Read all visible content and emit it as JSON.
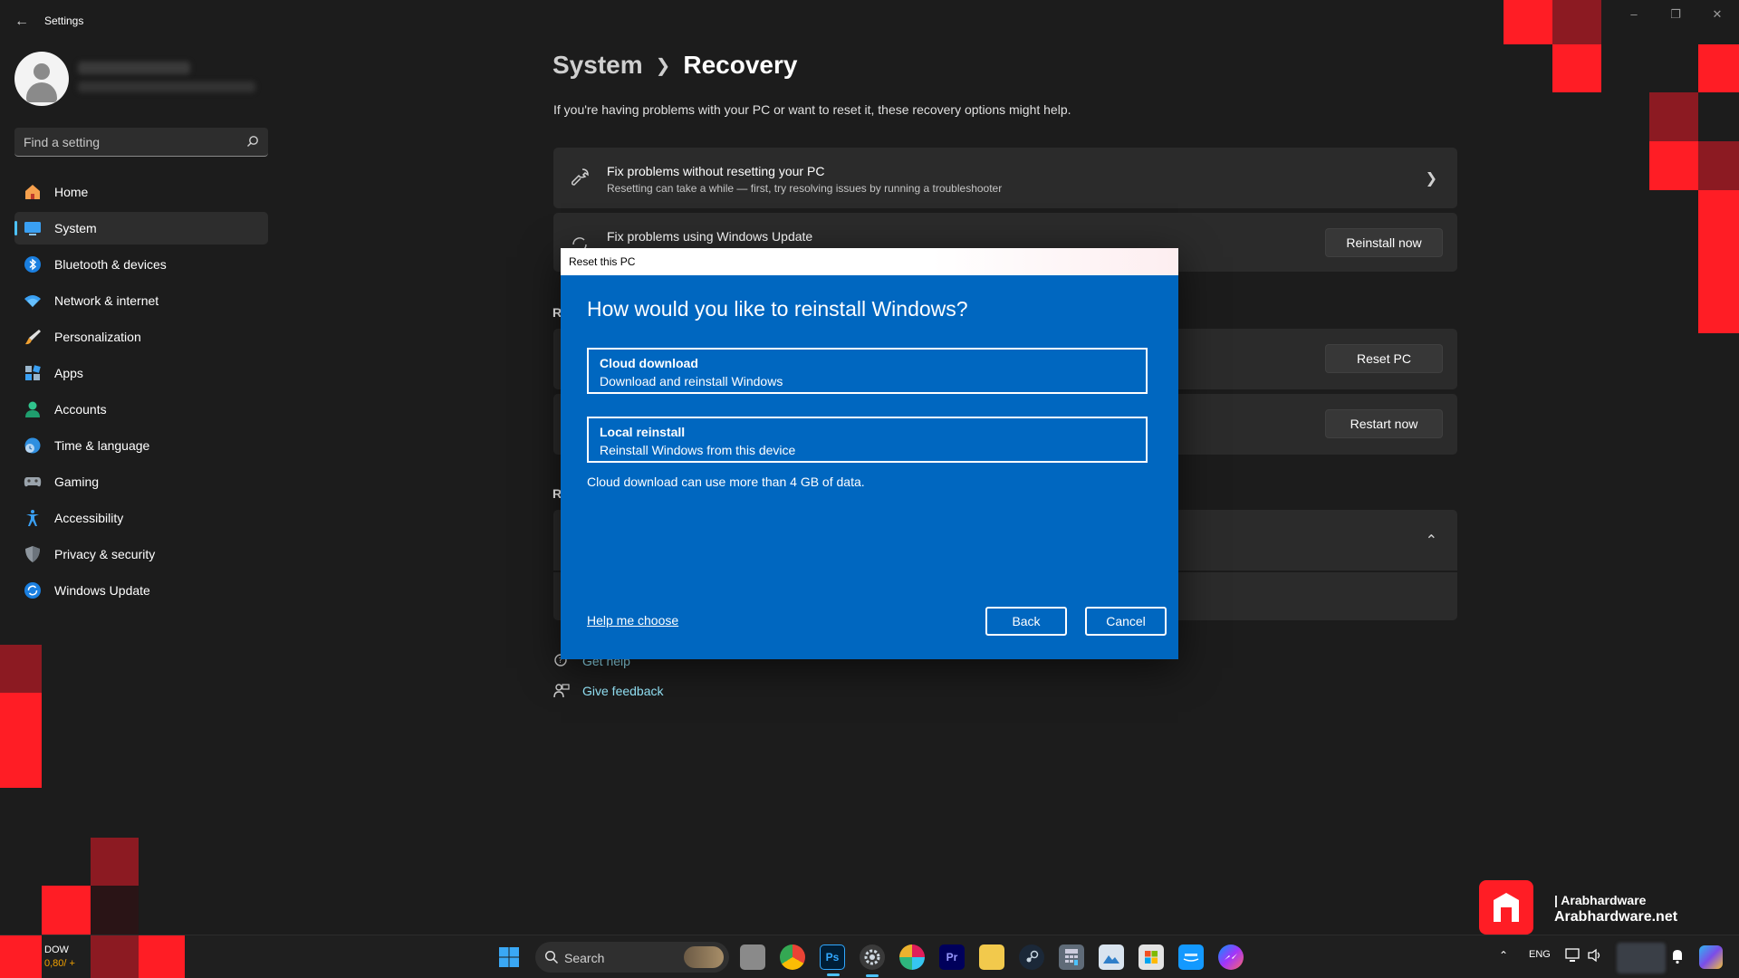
{
  "window": {
    "title": "Settings"
  },
  "search": {
    "placeholder": "Find a setting"
  },
  "sidebar": {
    "items": [
      {
        "label": "Home",
        "icon": "home-icon"
      },
      {
        "label": "System",
        "icon": "monitor-icon"
      },
      {
        "label": "Bluetooth & devices",
        "icon": "bluetooth-icon"
      },
      {
        "label": "Network & internet",
        "icon": "wifi-icon"
      },
      {
        "label": "Personalization",
        "icon": "brush-icon"
      },
      {
        "label": "Apps",
        "icon": "apps-icon"
      },
      {
        "label": "Accounts",
        "icon": "person-icon"
      },
      {
        "label": "Time & language",
        "icon": "globe-clock-icon"
      },
      {
        "label": "Gaming",
        "icon": "gamepad-icon"
      },
      {
        "label": "Accessibility",
        "icon": "accessibility-icon"
      },
      {
        "label": "Privacy & security",
        "icon": "shield-icon"
      },
      {
        "label": "Windows Update",
        "icon": "update-icon"
      }
    ],
    "active": "System"
  },
  "main": {
    "breadcrumb_parent": "System",
    "breadcrumb_current": "Recovery",
    "description": "If you're having problems with your PC or want to reset it, these recovery options might help.",
    "cards": [
      {
        "title": "Fix problems without resetting your PC",
        "subtitle": "Resetting can take a while — first, try resolving issues by running a troubleshooter"
      },
      {
        "title": "Fix problems using Windows Update",
        "button": "Reinstall now"
      }
    ],
    "section_letter_1": "R",
    "section_letter_2": "R",
    "reset_button": "Reset PC",
    "restart_button": "Restart now",
    "footer": {
      "get_help": "Get help",
      "give_feedback": "Give feedback"
    }
  },
  "dialog": {
    "title": "Reset this PC",
    "heading": "How would you like to reinstall Windows?",
    "options": [
      {
        "title": "Cloud download",
        "subtitle": "Download and reinstall Windows"
      },
      {
        "title": "Local reinstall",
        "subtitle": "Reinstall Windows from this device"
      }
    ],
    "note": "Cloud download can use more than 4 GB of data.",
    "help_link": "Help me choose",
    "back_button": "Back",
    "cancel_button": "Cancel"
  },
  "taskbar": {
    "weather_title": "DOW",
    "weather_value": "0,80/ +",
    "search_label": "Search",
    "tray_language": "ENG"
  },
  "watermark": {
    "handle": "| Arabhardware",
    "site": "Arabhardware.net"
  },
  "colors": {
    "accent": "#4cc2ff",
    "dialog_blue": "#0067c0",
    "red": "#ff1d25",
    "dark_red": "#8c1a22"
  }
}
